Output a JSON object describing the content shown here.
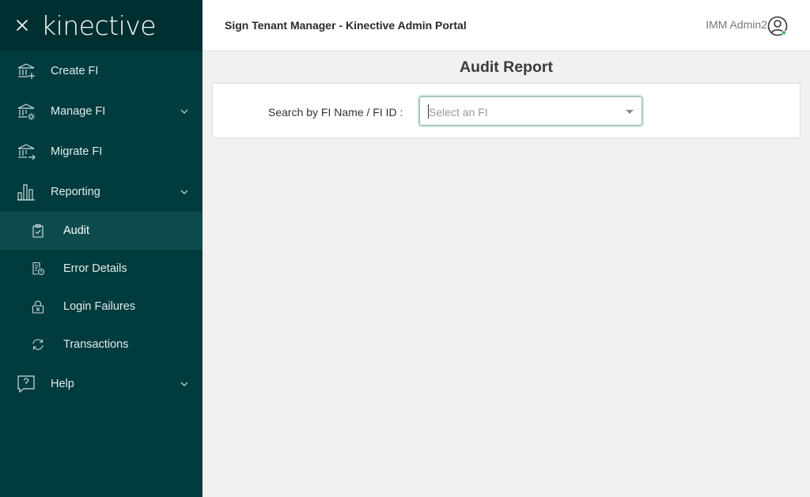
{
  "brand": {
    "logo_text": "kinective"
  },
  "header": {
    "title": "Sign Tenant Manager - Kinective Admin Portal",
    "user_name": "IMM Admin2"
  },
  "sidebar": {
    "items": [
      {
        "label": "Create FI",
        "icon": "bank-plus-icon"
      },
      {
        "label": "Manage FI",
        "icon": "bank-gear-icon",
        "expandable": true
      },
      {
        "label": "Migrate FI",
        "icon": "bank-arrow-icon"
      },
      {
        "label": "Reporting",
        "icon": "bar-chart-icon",
        "expandable": true
      }
    ],
    "reporting_sub": [
      {
        "label": "Audit",
        "icon": "clipboard-check-icon",
        "active": true
      },
      {
        "label": "Error Details",
        "icon": "document-alert-icon"
      },
      {
        "label": "Login Failures",
        "icon": "lock-x-icon"
      },
      {
        "label": "Transactions",
        "icon": "refresh-icon"
      }
    ],
    "help": {
      "label": "Help",
      "icon": "question-bubble-icon",
      "expandable": true
    }
  },
  "main": {
    "page_title": "Audit Report",
    "search_label": "Search by FI Name / FI ID :",
    "select": {
      "value": "",
      "placeholder": "Select an FI"
    }
  },
  "colors": {
    "sidebar_bg": "#003b3d",
    "sidebar_header_bg": "#002f31",
    "active_item_bg": "#0e4b4d",
    "focus_border": "#8fb6ad",
    "status_dot": "#3dbb5c"
  }
}
